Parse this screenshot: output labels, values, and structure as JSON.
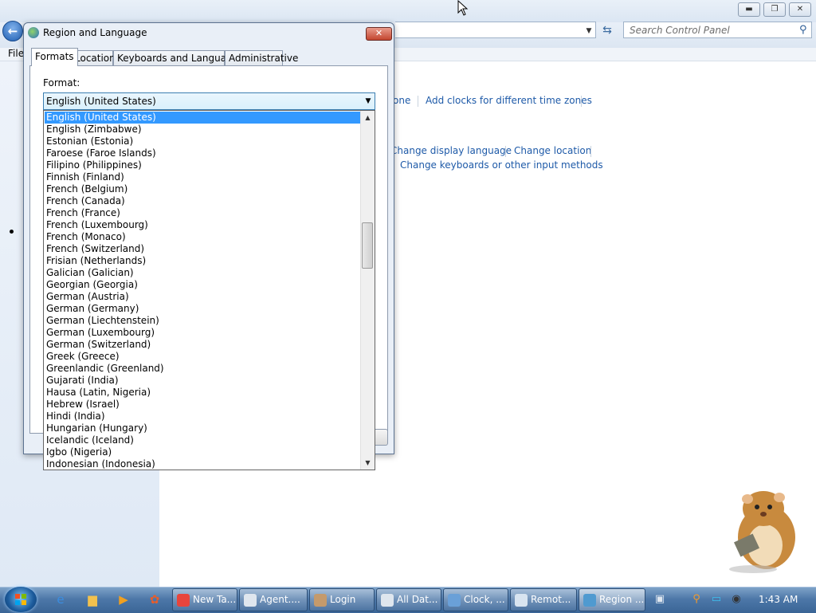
{
  "control_panel": {
    "menu_file": "File",
    "search_placeholder": "Search Control Panel",
    "links_row1": [
      "one",
      "Add clocks for different time zones"
    ],
    "links_row2": [
      "Change display language",
      "Change location"
    ],
    "links_row3": [
      "Change keyboards or other input methods"
    ]
  },
  "dialog": {
    "title": "Region and Language",
    "tabs": [
      "Formats",
      "Location",
      "Keyboards and Languages",
      "Administrative"
    ],
    "active_tab": "Formats",
    "format_label": "Format:",
    "format_selected": "English (United States)",
    "options": [
      "English (United States)",
      "English (Zimbabwe)",
      "Estonian (Estonia)",
      "Faroese (Faroe Islands)",
      "Filipino (Philippines)",
      "Finnish (Finland)",
      "French (Belgium)",
      "French (Canada)",
      "French (France)",
      "French (Luxembourg)",
      "French (Monaco)",
      "French (Switzerland)",
      "Frisian (Netherlands)",
      "Galician (Galician)",
      "Georgian (Georgia)",
      "German (Austria)",
      "German (Germany)",
      "German (Liechtenstein)",
      "German (Luxembourg)",
      "German (Switzerland)",
      "Greek (Greece)",
      "Greenlandic (Greenland)",
      "Gujarati (India)",
      "Hausa (Latin, Nigeria)",
      "Hebrew (Israel)",
      "Hindi (India)",
      "Hungarian (Hungary)",
      "Icelandic (Iceland)",
      "Igbo (Nigeria)",
      "Indonesian (Indonesia)"
    ],
    "selected_index": 0
  },
  "taskbar": {
    "buttons": [
      {
        "label": "New Ta...",
        "icon": "chrome-icon",
        "color": "#e8453c"
      },
      {
        "label": "Agent....",
        "icon": "window-icon",
        "color": "#dfe6ee"
      },
      {
        "label": "Login",
        "icon": "person-icon",
        "color": "#c49a6c"
      },
      {
        "label": "All Dat...",
        "icon": "window-icon",
        "color": "#dfe6ee"
      },
      {
        "label": "Clock, ...",
        "icon": "control-panel-icon",
        "color": "#6aa0d8"
      },
      {
        "label": "Remot...",
        "icon": "remote-desktop-icon",
        "color": "#d8e4f0"
      },
      {
        "label": "Region ...",
        "icon": "globe-icon",
        "color": "#4f9ad0"
      }
    ],
    "clock": "1:43 AM"
  }
}
